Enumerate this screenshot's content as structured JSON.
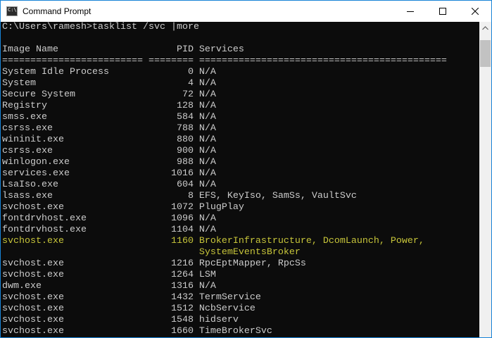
{
  "window": {
    "title": "Command Prompt",
    "icon": "cmd-icon",
    "icon_text": "C:\\"
  },
  "console": {
    "prompt": "C:\\Users\\ramesh>tasklist /svc |more",
    "blank": "",
    "header": "Image Name                     PID Services",
    "separator": "========================= ======== ============================================",
    "rows": [
      "System Idle Process              0 N/A",
      "System                           4 N/A",
      "Secure System                   72 N/A",
      "Registry                       128 N/A",
      "smss.exe                       584 N/A",
      "csrss.exe                      788 N/A",
      "wininit.exe                    880 N/A",
      "csrss.exe                      900 N/A",
      "winlogon.exe                   988 N/A",
      "services.exe                  1016 N/A",
      "LsaIso.exe                     604 N/A",
      "lsass.exe                        8 EFS, KeyIso, SamSs, VaultSvc",
      "svchost.exe                   1072 PlugPlay",
      "fontdrvhost.exe               1096 N/A",
      "fontdrvhost.exe               1104 N/A",
      "svchost.exe                   1160 BrokerInfrastructure, DcomLaunch, Power,",
      "                                   SystemEventsBroker",
      "svchost.exe                   1216 RpcEptMapper, RpcSs",
      "svchost.exe                   1264 LSM",
      "dwm.exe                       1316 N/A",
      "svchost.exe                   1432 TermService",
      "svchost.exe                   1512 NcbService",
      "svchost.exe                   1548 hidserv",
      "svchost.exe                   1660 TimeBrokerSvc"
    ]
  },
  "colors": {
    "console_bg": "#0c0c0c",
    "console_text": "#cccccc",
    "highlight_text": "#c7c53a",
    "window_border": "#1883d7"
  },
  "icons": {
    "minimize": "minimize-icon",
    "maximize": "maximize-icon",
    "close": "close-icon",
    "scroll_up": "chevron-up-icon",
    "scroll_down": "chevron-down-icon"
  }
}
